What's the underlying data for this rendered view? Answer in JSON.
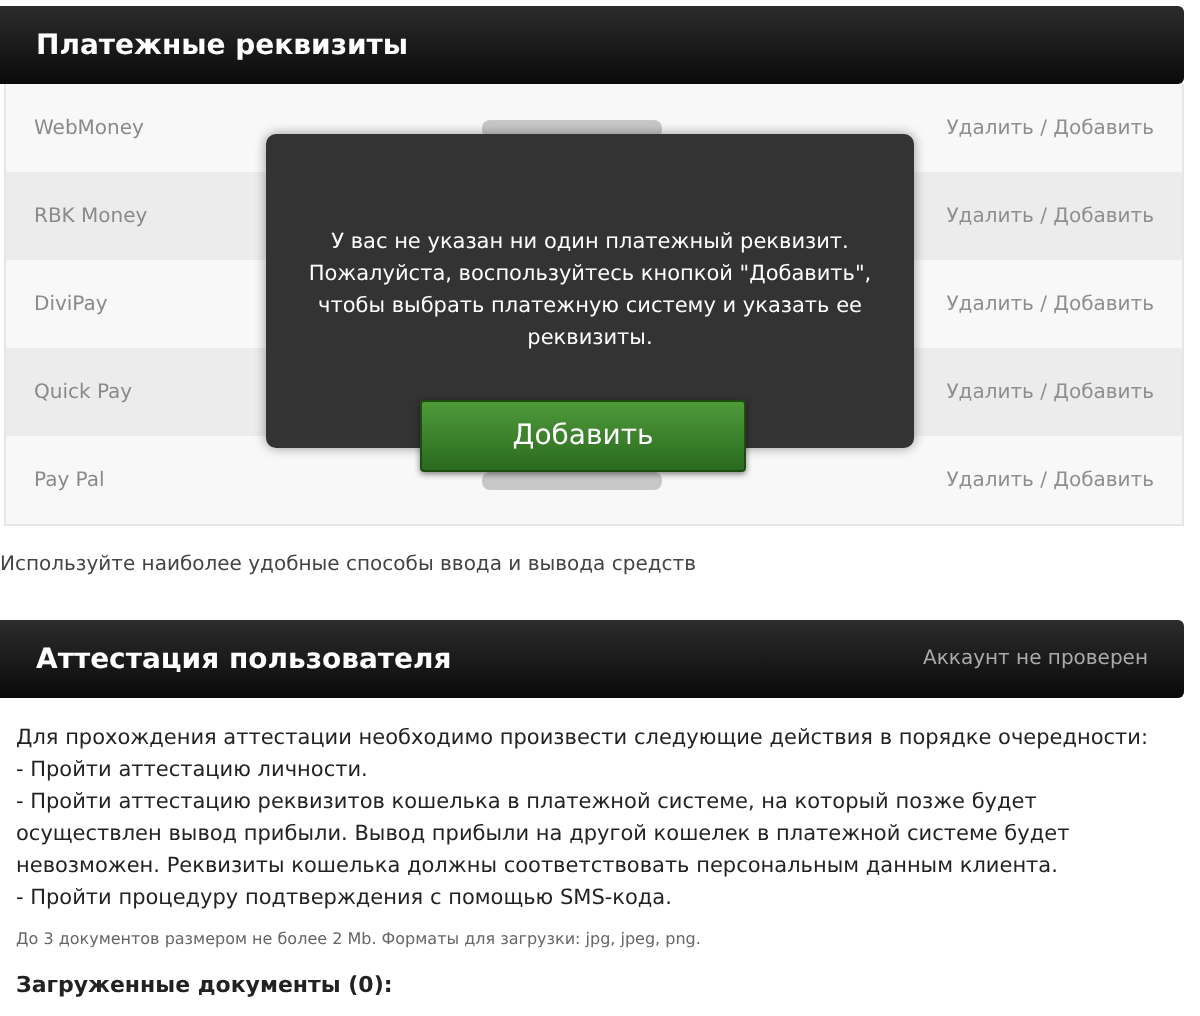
{
  "payment_panel": {
    "title": "Платежные реквизиты",
    "rows": [
      {
        "system": "WebMoney",
        "actions": "Удалить / Добавить"
      },
      {
        "system": "RBK Money",
        "actions": "Удалить / Добавить"
      },
      {
        "system": "DiviPay",
        "actions": "Удалить / Добавить"
      },
      {
        "system": "Quick Pay",
        "actions": "Удалить / Добавить"
      },
      {
        "system": "Pay Pal",
        "actions": "Удалить / Добавить"
      }
    ],
    "dialog": {
      "message": "У вас не указан ни один платежный реквизит. Пожалуйста, воспользуйтесь кнопкой \"Добавить\", чтобы выбрать платежную систему и указать ее реквизиты.",
      "button": "Добавить"
    },
    "note": "Используйте наиболее удобные способы ввода и вывода средств"
  },
  "verification_panel": {
    "title": "Аттестация пользователя",
    "status": "Аккаунт не проверен",
    "lines": [
      "Для прохождения аттестации необходимо произвести следующие действия в порядке очередности:",
      "- Пройти аттестацию личности.",
      "- Пройти аттестацию реквизитов кошелька в платежной системе, на который позже будет осуществлен вывод прибыли. Вывод прибыли на другой кошелек в платежной системе будет невозможен. Реквизиты кошелька должны соответствовать персональным данным клиента.",
      "- Пройти процедуру подтверждения с помощью SMS-кода."
    ],
    "upload_hint": "До 3 документов размером не более 2 Mb. Форматы для загрузки: jpg, jpeg, png.",
    "uploaded_heading": "Загруженные документы (0):"
  }
}
